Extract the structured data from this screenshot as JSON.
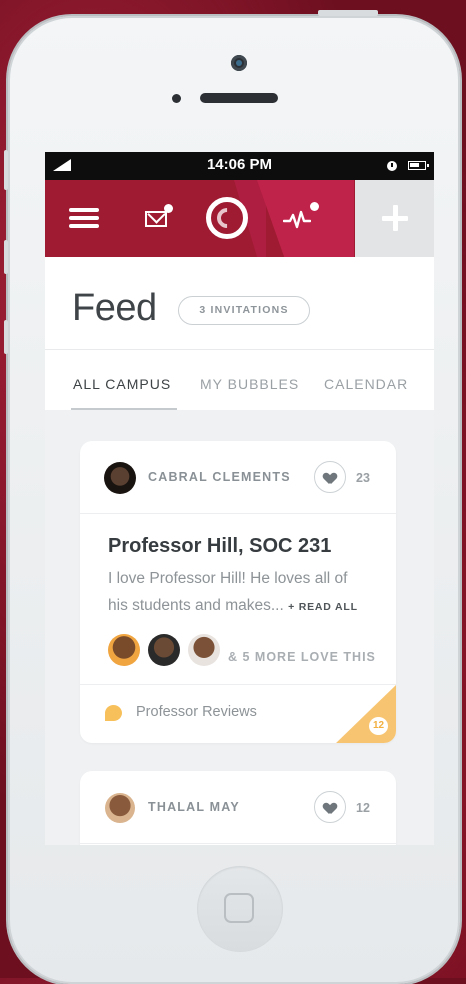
{
  "status_bar": {
    "time": "14:06 PM"
  },
  "nav": {
    "menu_icon": "hamburger-icon",
    "mail_icon": "envelope-icon",
    "logo_icon": "bubble-logo-icon",
    "activity_icon": "pulse-icon",
    "add_icon": "plus-icon"
  },
  "feed": {
    "title": "Feed",
    "invitations": "3 INVITATIONS"
  },
  "tabs": [
    {
      "label": "ALL CAMPUS",
      "active": true
    },
    {
      "label": "MY BUBBLES",
      "active": false
    },
    {
      "label": "CALENDAR",
      "active": false
    }
  ],
  "posts": [
    {
      "author": "CABRAL CLEMENTS",
      "likes": "23",
      "title": "Professor Hill, SOC 231",
      "body": "I love Professor Hill! He loves all of his students and makes...",
      "read_all": "+ READ ALL",
      "more_love": "& 5 MORE LOVE THIS",
      "topic": "Professor Reviews",
      "comments": "12"
    },
    {
      "author": "THALAL MAY",
      "likes": "12"
    }
  ],
  "colors": {
    "brand": "#9e1b32",
    "brand_light": "#c0234a",
    "topic_accent": "#f7c05a"
  }
}
